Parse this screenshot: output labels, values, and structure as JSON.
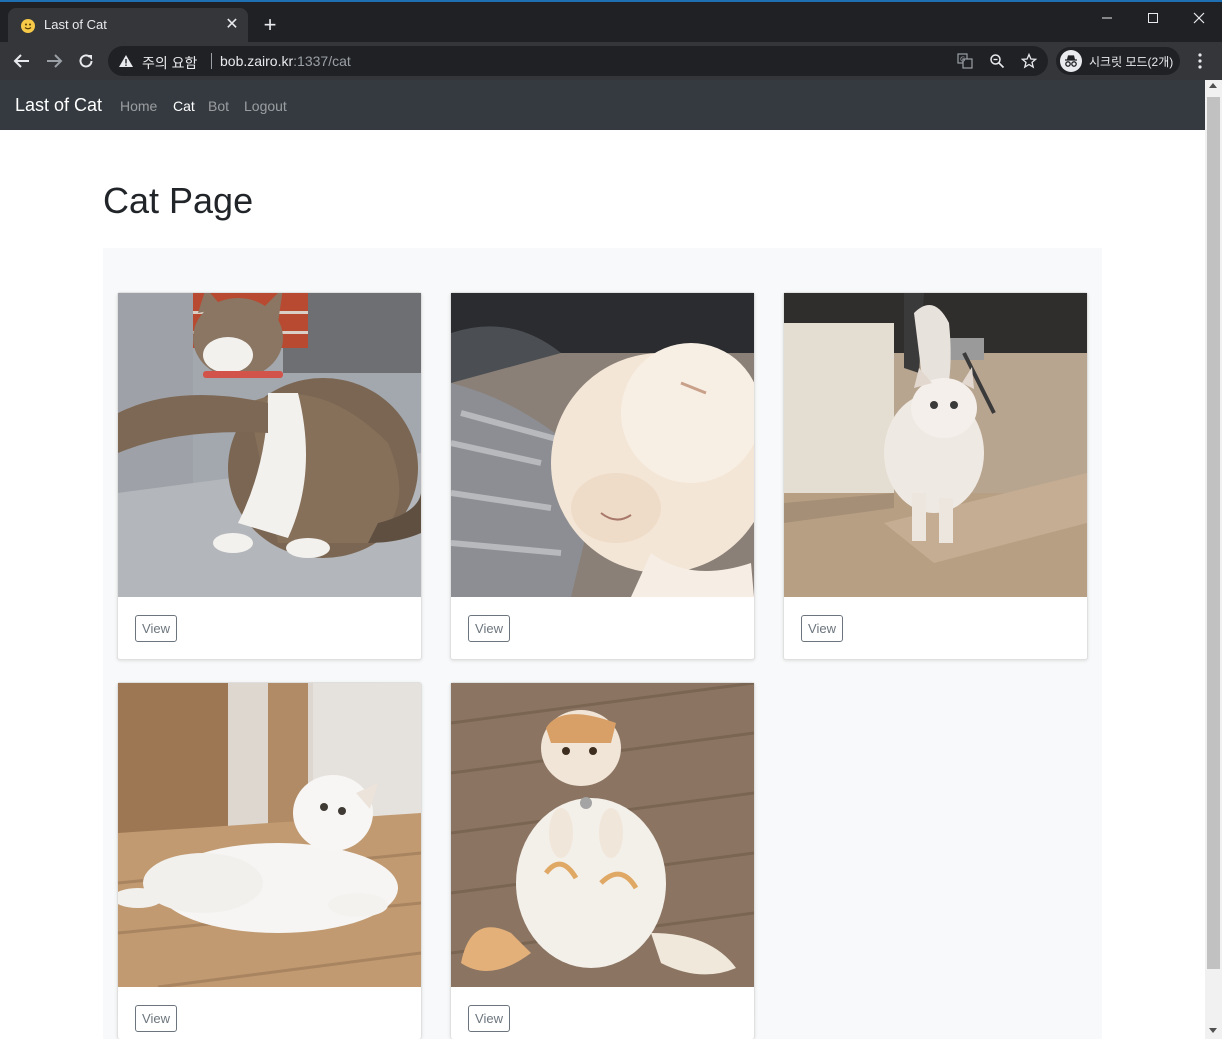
{
  "browser": {
    "tab_title": "Last of Cat",
    "tab_close": "✕",
    "new_tab": "+",
    "security_warning": "주의 요함",
    "url_host": "bob.zairo.kr",
    "url_path": ":1337/cat",
    "incognito_label": "시크릿 모드(2개)"
  },
  "navbar": {
    "brand": "Last of Cat",
    "links": [
      {
        "label": "Home",
        "active": false
      },
      {
        "label": "Cat",
        "active": true
      },
      {
        "label": "Bot",
        "active": false
      },
      {
        "label": "Logout",
        "active": false
      }
    ]
  },
  "page": {
    "title": "Cat Page"
  },
  "cards": [
    {
      "image": "tabby-cat-sitting-photo",
      "button": "View"
    },
    {
      "image": "sleeping-white-cat-photo",
      "button": "View"
    },
    {
      "image": "fluffy-white-cat-standing-photo",
      "button": "View"
    },
    {
      "image": "white-fold-cat-lying-photo",
      "button": "View"
    },
    {
      "image": "orange-white-fold-cat-sitting-photo",
      "button": "View"
    }
  ],
  "colors": {
    "navbar_bg": "#343a40",
    "album_bg": "#f8f9fa",
    "button_outline": "#6c757d"
  }
}
